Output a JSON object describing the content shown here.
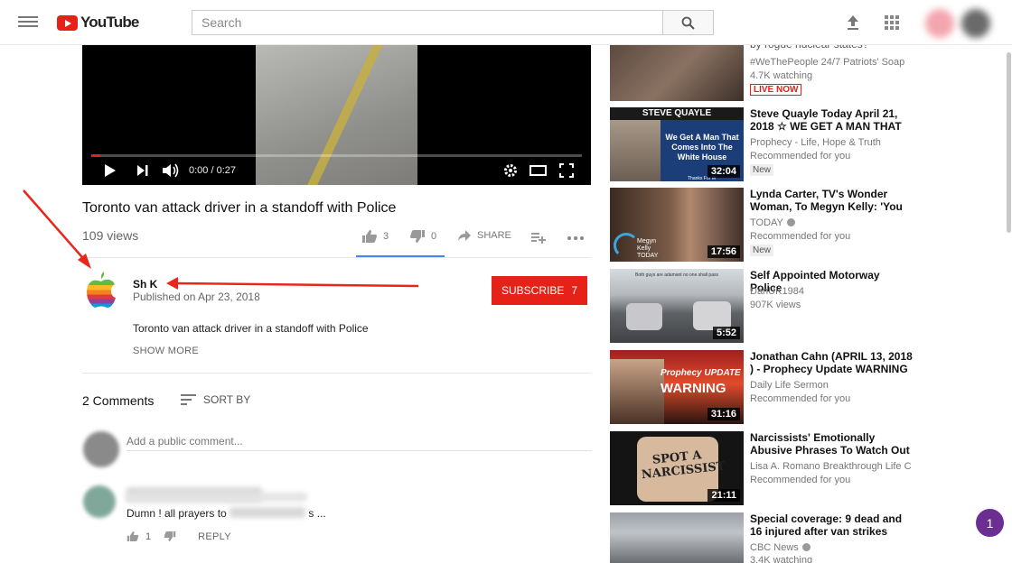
{
  "header": {
    "logo_text": "YouTube",
    "search_placeholder": "Search"
  },
  "player": {
    "time_display": "0:00 / 0:27",
    "progress_fraction": 0.0
  },
  "video": {
    "title": "Toronto van attack driver in a standoff with Police",
    "views": "109 views",
    "likes": "3",
    "dislikes": "0",
    "share_label": "SHARE"
  },
  "channel": {
    "name": "Sh K",
    "published": "Published on Apr 23, 2018",
    "subscribe_label": "SUBSCRIBE",
    "subscriber_count": "7",
    "description": "Toronto van attack driver in a standoff with Police",
    "show_more": "SHOW MORE"
  },
  "comments": {
    "count_label": "2 Comments",
    "sort_label": "SORT BY",
    "input_placeholder": "Add a public comment...",
    "first_comment": {
      "text_left": "Dumn ! all prayers to",
      "text_right": "s ...",
      "likes": "1",
      "reply_label": "REPLY"
    }
  },
  "sidebar": {
    "items": [
      {
        "title_line": "by rogue nuclear states?",
        "channel": "#WeThePeople 24/7 Patriots' Soap",
        "meta": "4.7K watching",
        "badge": "LIVE NOW"
      },
      {
        "title": "Steve Quayle Today April 21, 2018 ☆ WE GET A MAN THAT",
        "channel": "Prophecy - Life, Hope & Truth",
        "meta": "Recommended for you",
        "badge": "New",
        "duration": "32:04",
        "thumb_header": "STEVE QUAYLE",
        "thumb_text": "We Get A Man That Comes Into The White House",
        "thumb_caption": "Thanks For W"
      },
      {
        "title": "Lynda Carter, TV's Wonder Woman, To Megyn Kelly: 'You",
        "channel": "TODAY",
        "meta": "Recommended for you",
        "badge": "New",
        "duration": "17:56",
        "thumb_text": "Megyn Kelly TODAY"
      },
      {
        "title": "Self Appointed Motorway Police",
        "channel": "DanUK1984",
        "meta": "907K views",
        "duration": "5:52",
        "thumb_text": "Both guys are adamant no one shall pass"
      },
      {
        "title": "Jonathan Cahn (APRIL 13, 2018 ) - Prophecy Update WARNING",
        "channel": "Daily Life Sermon",
        "meta": "Recommended for you",
        "duration": "31:16",
        "thumb_text": "Prophecy UPDATE",
        "thumb_text2": "WARNING"
      },
      {
        "title": "Narcissists' Emotionally Abusive Phrases To Watch Out",
        "channel": "Lisa A. Romano Breakthrough Life C",
        "meta": "Recommended for you",
        "duration": "21:11",
        "thumb_text": "SPOT A NARCISSIST"
      },
      {
        "title": "Special coverage: 9 dead and 16 injured after van strikes",
        "channel": "CBC News",
        "meta": "3.4K watching"
      }
    ]
  },
  "notification_count": "1",
  "colors": {
    "brand_red": "#e62117",
    "like_underline": "#4285f4",
    "notification_purple": "#6b2e92"
  }
}
